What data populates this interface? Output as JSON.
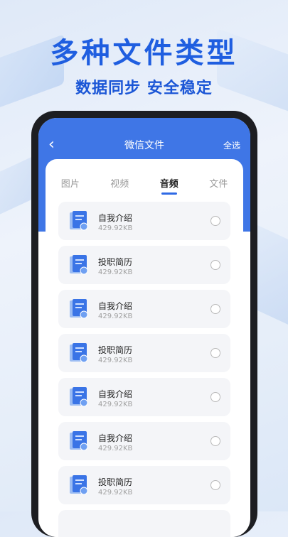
{
  "promo": {
    "headline": "多种文件类型",
    "subline": "数据同步 安全稳定"
  },
  "app": {
    "title": "微信文件",
    "back_icon": "back-arrow-icon",
    "select_all": "全选",
    "accent_color": "#3f76e6"
  },
  "tabs": [
    {
      "label": "图片",
      "active": false
    },
    {
      "label": "视频",
      "active": false
    },
    {
      "label": "音频",
      "active": true
    },
    {
      "label": "文件",
      "active": false
    }
  ],
  "files": [
    {
      "name": "自我介绍",
      "size": "429.92KB"
    },
    {
      "name": "投职简历",
      "size": "429.92KB"
    },
    {
      "name": "自我介绍",
      "size": "429.92KB"
    },
    {
      "name": "投职简历",
      "size": "429.92KB"
    },
    {
      "name": "自我介绍",
      "size": "429.92KB"
    },
    {
      "name": "自我介绍",
      "size": "429.92KB"
    },
    {
      "name": "投职简历",
      "size": "429.92KB"
    }
  ]
}
